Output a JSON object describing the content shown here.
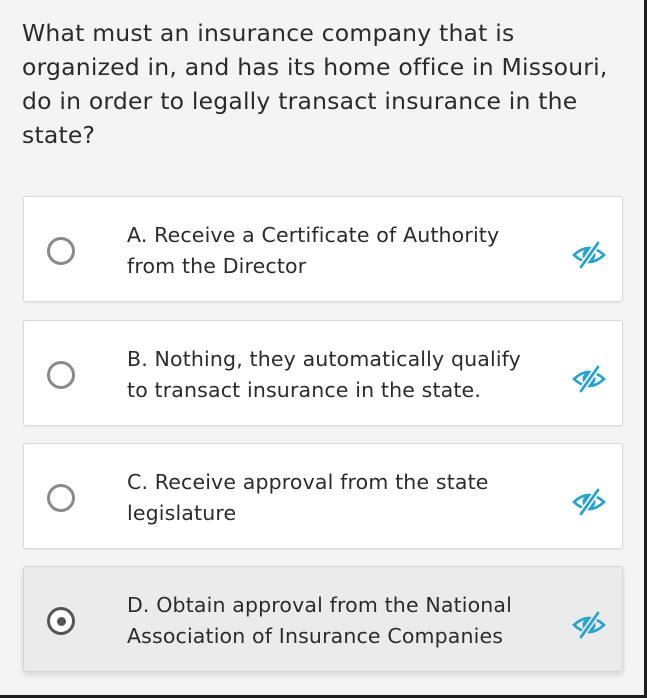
{
  "question": {
    "text": "What must an insurance company that is organized in, and has its home office in Missouri, do in order to legally transact insurance in the state?"
  },
  "options": [
    {
      "text": "A. Receive a Certificate of Authority from the Director",
      "selected": false,
      "hide_icon": "eye-slash-icon"
    },
    {
      "text": "B. Nothing, they automatically qualify to transact insurance in the state.",
      "selected": false,
      "hide_icon": "eye-slash-icon"
    },
    {
      "text": "C. Receive approval from the state legislature",
      "selected": false,
      "hide_icon": "eye-slash-icon"
    },
    {
      "text": "D. Obtain approval from the National Association of Insurance Companies",
      "selected": true,
      "hide_icon": "eye-slash-icon"
    }
  ],
  "colors": {
    "accent": "#2aa3c9",
    "text": "#2b2b2b",
    "background": "#f4f4f4",
    "card": "#ffffff",
    "card_selected": "#ebebeb"
  }
}
